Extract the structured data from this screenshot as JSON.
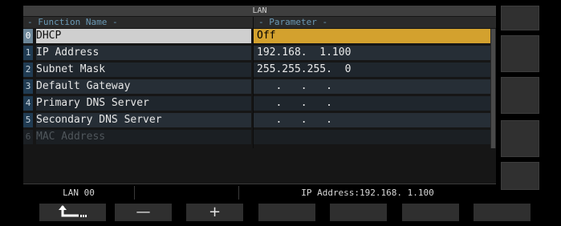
{
  "window": {
    "title": "LAN"
  },
  "columns": {
    "function": "- Function Name -",
    "parameter": "- Parameter -"
  },
  "rows": [
    {
      "index": "0",
      "name": "DHCP",
      "value": "Off"
    },
    {
      "index": "1",
      "name": "IP Address",
      "value": "192.168.  1.100"
    },
    {
      "index": "2",
      "name": "Subnet Mask",
      "value": "255.255.255.  0"
    },
    {
      "index": "3",
      "name": "Default Gateway",
      "value": "   .   .   ."
    },
    {
      "index": "4",
      "name": "Primary DNS Server",
      "value": "   .   .   ."
    },
    {
      "index": "5",
      "name": "Secondary DNS Server",
      "value": "   .   .   ."
    },
    {
      "index": "6",
      "name": "MAC Address",
      "value": ""
    }
  ],
  "status": {
    "left": "LAN 00",
    "middle": "",
    "right": "IP Address:192.168.  1.100"
  },
  "function_keys": [
    {
      "label": "",
      "icon": "return-arrow-icon"
    },
    {
      "label": "—"
    },
    {
      "label": "+"
    },
    {
      "label": ""
    },
    {
      "label": ""
    },
    {
      "label": ""
    },
    {
      "label": ""
    }
  ],
  "colors": {
    "selected_value": "#d3a12e",
    "selected_name": "#cfcfcf",
    "index_badge": "#203b52"
  }
}
